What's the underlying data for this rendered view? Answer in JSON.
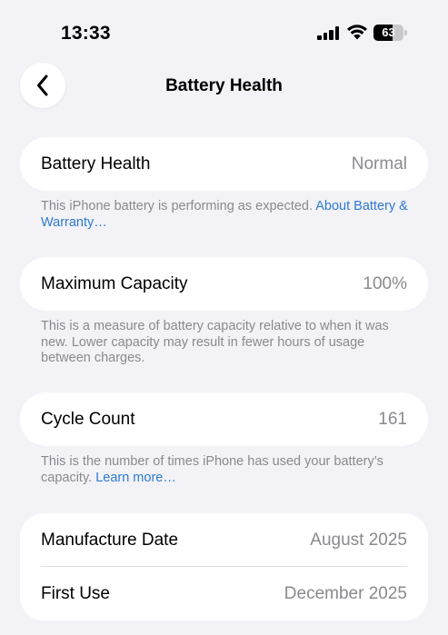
{
  "status_bar": {
    "time": "13:33",
    "battery_level": "63",
    "battery_fraction": 0.63
  },
  "nav": {
    "title": "Battery Health",
    "back_icon": "chevron-left-icon"
  },
  "battery_health": {
    "label": "Battery Health",
    "value": "Normal",
    "footnote": "This iPhone battery is performing as expected. ",
    "footnote_link": "About Battery & Warranty…"
  },
  "maximum_capacity": {
    "label": "Maximum Capacity",
    "value": "100%",
    "footnote": "This is a measure of battery capacity relative to when it was new. Lower capacity may result in fewer hours of usage between charges."
  },
  "cycle_count": {
    "label": "Cycle Count",
    "value": "161",
    "footnote": "This is the number of times iPhone has used your battery’s capacity. ",
    "footnote_link": "Learn more…"
  },
  "dates": {
    "manufacture_label": "Manufacture Date",
    "manufacture_value": "August 2025",
    "first_use_label": "First Use",
    "first_use_value": "December 2025"
  },
  "colors": {
    "background": "#f2f2f7",
    "link": "#2f7ad0",
    "secondary_text": "#8a8a8e"
  }
}
